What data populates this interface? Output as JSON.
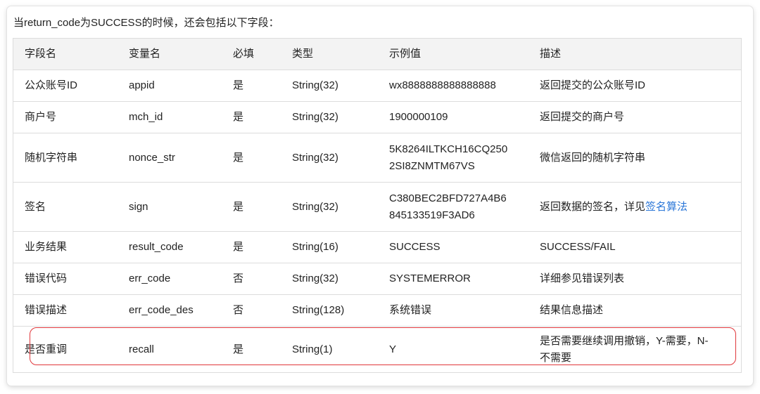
{
  "intro_text": "当return_code为SUCCESS的时候，还会包括以下字段：",
  "headers": [
    "字段名",
    "变量名",
    "必填",
    "类型",
    "示例值",
    "描述"
  ],
  "rows": [
    {
      "field": "公众账号ID",
      "var": "appid",
      "req": "是",
      "type": "String(32)",
      "example": "wx8888888888888888",
      "desc": "返回提交的公众账号ID"
    },
    {
      "field": "商户号",
      "var": "mch_id",
      "req": "是",
      "type": "String(32)",
      "example": "1900000109",
      "desc": "返回提交的商户号"
    },
    {
      "field": "随机字符串",
      "var": "nonce_str",
      "req": "是",
      "type": "String(32)",
      "example_line1": "5K8264ILTKCH16CQ250",
      "example_line2": "2SI8ZNMTM67VS",
      "desc": "微信返回的随机字符串"
    },
    {
      "field": "签名",
      "var": "sign",
      "req": "是",
      "type": "String(32)",
      "example_line1": "C380BEC2BFD727A4B6",
      "example_line2": "845133519F3AD6",
      "desc_prefix": "返回数据的签名，详见",
      "desc_link": "签名算法"
    },
    {
      "field": "业务结果",
      "var": "result_code",
      "req": "是",
      "type": "String(16)",
      "example": "SUCCESS",
      "desc": "SUCCESS/FAIL"
    },
    {
      "field": "错误代码",
      "var": "err_code",
      "req": "否",
      "type": "String(32)",
      "example": "SYSTEMERROR",
      "desc": "详细参见错误列表"
    },
    {
      "field": "错误描述",
      "var": "err_code_des",
      "req": "否",
      "type": "String(128)",
      "example": "系统错误",
      "desc": "结果信息描述"
    },
    {
      "field": "是否重调",
      "var": "recall",
      "req": "是",
      "type": "String(1)",
      "example": "Y",
      "desc_line1": "是否需要继续调用撤销，Y-需要，N-",
      "desc_line2": "不需要"
    }
  ],
  "colors": {
    "highlight": "#e0373b",
    "link": "#2b77d8",
    "header_bg": "#f3f3f3",
    "border": "#dcdcdc"
  }
}
